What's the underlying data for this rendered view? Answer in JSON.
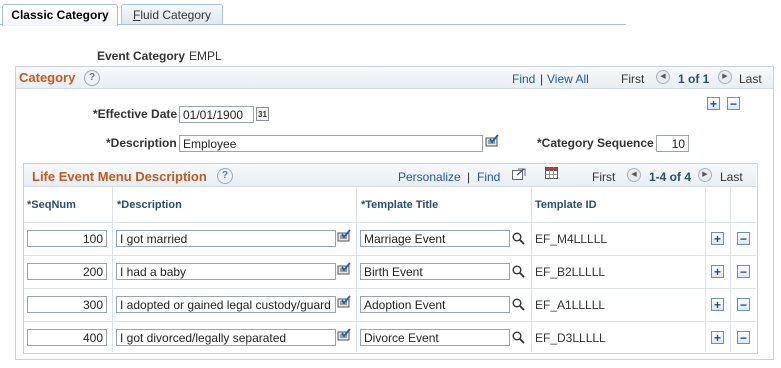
{
  "tabs": {
    "classic": "Classic Category",
    "fluid_pre": "",
    "fluid_u": "F",
    "fluid_post": "luid Category"
  },
  "event_category": {
    "label": "Event Category",
    "value": "EMPL"
  },
  "category": {
    "title": "Category",
    "help": "?",
    "find": "Find",
    "sep": "|",
    "view_all": "View All",
    "first": "First",
    "range": "1 of 1",
    "last": "Last",
    "effective_date_label": "*Effective Date",
    "effective_date_value": "01/01/1900",
    "calendar_icon_text": "31",
    "description_label": "*Description",
    "description_value": "Employee",
    "category_sequence_label": "*Category Sequence",
    "category_sequence_value": "10"
  },
  "grid": {
    "title": "Life Event Menu Description",
    "help": "?",
    "personalize": "Personalize",
    "sep": "|",
    "find": "Find",
    "first": "First",
    "range": "1-4 of 4",
    "last": "Last",
    "columns": {
      "seqnum": "*SeqNum",
      "description": "*Description",
      "template_title": "*Template Title",
      "template_id": "Template ID"
    },
    "rows": [
      {
        "seqnum": "100",
        "description": "I got married",
        "template_title": "Marriage Event",
        "template_id": "EF_M4LLLLL"
      },
      {
        "seqnum": "200",
        "description": "I had a baby",
        "template_title": "Birth Event",
        "template_id": "EF_B2LLLLL"
      },
      {
        "seqnum": "300",
        "description": "I adopted or gained legal custody/guard",
        "template_title": "Adoption Event",
        "template_id": "EF_A1LLLLL"
      },
      {
        "seqnum": "400",
        "description": "I got divorced/legally separated",
        "template_title": "Divorce Event",
        "template_id": "EF_D3LLLLL"
      }
    ]
  },
  "icons": {
    "plus": "+",
    "minus": "−",
    "prev": "◀",
    "next": "▶"
  },
  "colors": {
    "section_title": "#c25b1e",
    "link": "#2255a4",
    "column_header": "#2a4d73"
  }
}
